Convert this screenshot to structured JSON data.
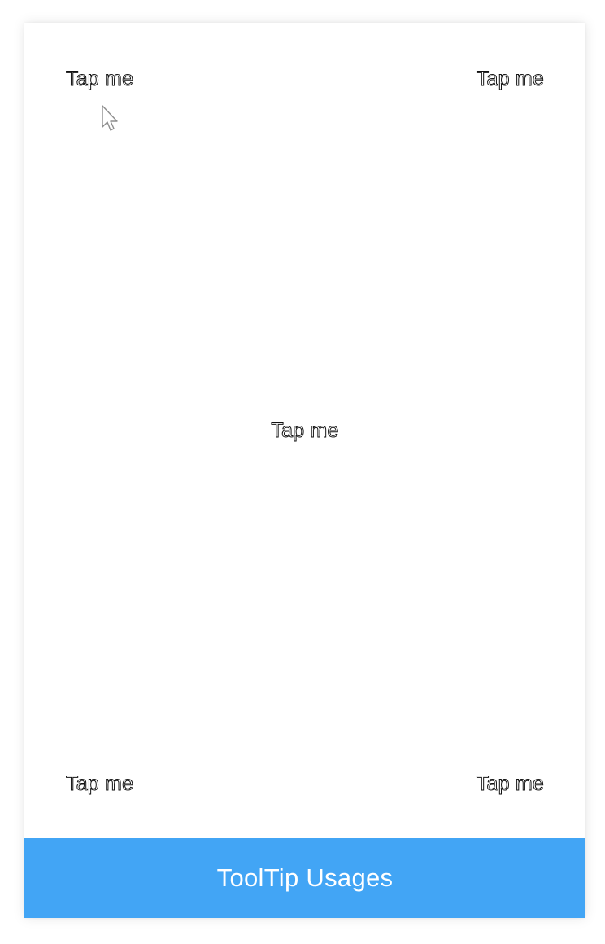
{
  "screen": {
    "tap_top_left": "Tap me",
    "tap_top_right": "Tap me",
    "tap_center": "Tap me",
    "tap_bottom_left": "Tap me",
    "tap_bottom_right": "Tap me"
  },
  "bottom_bar": {
    "title": "ToolTip Usages",
    "color": "#42a5f5"
  },
  "icons": {
    "cursor": "mouse-pointer-icon"
  }
}
